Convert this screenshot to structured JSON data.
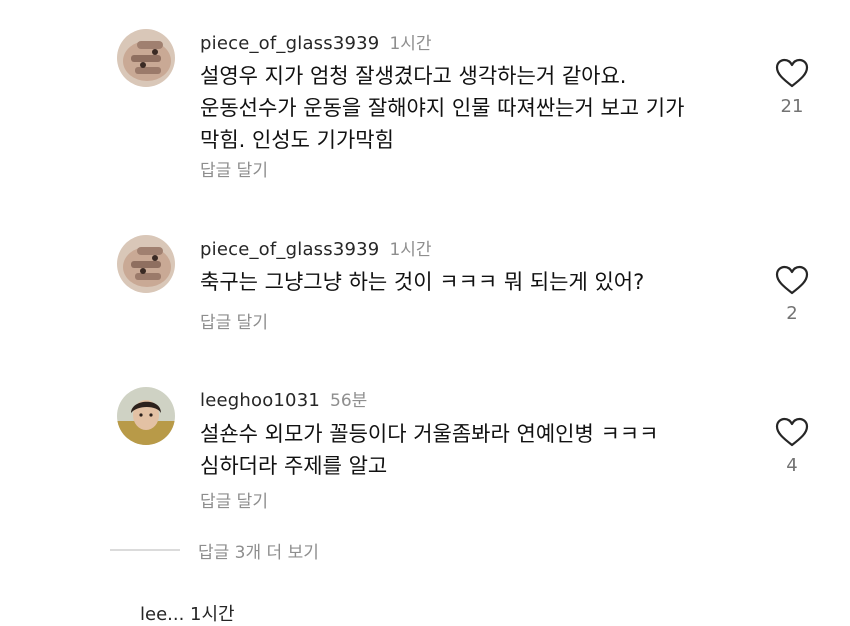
{
  "comments": [
    {
      "username": "piece_of_glass3939",
      "time": "1시간",
      "lines": [
        "설영우 지가 엄청 잘생겼다고 생각하는거 같아요.",
        "운동선수가 운동을 잘해야지 인물 따져싼는거 보고 기가",
        "막힘. 인성도 기가막힘"
      ],
      "reply_label": "답글 달기",
      "likes": "21",
      "like_icon": "heart-outline-icon"
    },
    {
      "username": "piece_of_glass3939",
      "time": "1시간",
      "lines": [
        "축구는 그냥그냥 하는 것이 ㅋㅋㅋ 뭐 되는게 있어?"
      ],
      "reply_label": "답글 달기",
      "likes": "2",
      "like_icon": "heart-outline-icon"
    },
    {
      "username": "leeghoo1031",
      "time": "56분",
      "lines": [
        "설숀수 외모가 꼴등이다 거울좀봐라 연예인병 ㅋㅋㅋ",
        "심하더라 주제를 알고"
      ],
      "reply_label": "답글 달기",
      "likes": "4",
      "like_icon": "heart-outline-icon"
    }
  ],
  "view_replies_label": "답글 3개 더 보기",
  "next_comment_partial": "lee... 1시간"
}
